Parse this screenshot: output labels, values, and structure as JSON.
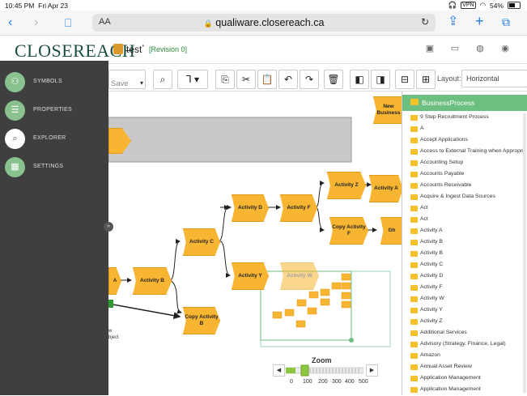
{
  "status_bar": {
    "time": "10:45 PM",
    "date": "Fri Apr 23",
    "battery": "54%"
  },
  "browser": {
    "aa": "AA",
    "url": "qualiware.closereach.ca",
    "lock": "🔒"
  },
  "app": {
    "logo": "CLOSEREACH",
    "doc_title": "test",
    "doc_modified": "*",
    "revision": "[Revision 0]"
  },
  "toolbar": {
    "save_label": "Save",
    "layout_label": "Layout:",
    "layout_value": "Horizontal"
  },
  "nav": [
    {
      "label": "SYMBOLS",
      "icon": "symbols-icon"
    },
    {
      "label": "PROPERTIES",
      "icon": "properties-icon"
    },
    {
      "label": "EXPLORER",
      "icon": "explorer-icon"
    },
    {
      "label": "SETTINGS",
      "icon": "settings-icon"
    }
  ],
  "canvas": {
    "shapes": [
      "New Business",
      "Activity D",
      "Activity F",
      "Activity Z",
      "Activity A",
      "Activity C",
      "Copy Activity F",
      "Gh",
      "Activity B",
      "Activity Y",
      "Activity W",
      "Copy Activity B"
    ],
    "partial_label": "A",
    "partial_text": "w\nbject"
  },
  "explorer": {
    "header": "BusinessProcess",
    "items": [
      "9 Step Recruitment Process",
      "A",
      "Accept Applications",
      "Access to External Training when Appropri",
      "Accounting Setup",
      "Accounts Payable",
      "Accounts Receivable",
      "Acquire & Ingest Data Sources",
      "Act",
      "Act",
      "Activity A",
      "Activity B",
      "Activity B",
      "Activity C",
      "Activity D",
      "Activity F",
      "Activity W",
      "Activity Y",
      "Activity Z",
      "Additional Services",
      "Advisory (Strategy, Finance, Legal)",
      "Amazon",
      "Annual Asset Review",
      "Application Management",
      "Application Management"
    ]
  },
  "zoom": {
    "label": "Zoom",
    "ticks": [
      "0",
      "100",
      "200",
      "300",
      "400",
      "500"
    ],
    "level_percent": 10
  },
  "colors": {
    "accent_green": "#6dbf80",
    "shape_fill": "#f8b531",
    "brand": "#1b4f3c"
  }
}
